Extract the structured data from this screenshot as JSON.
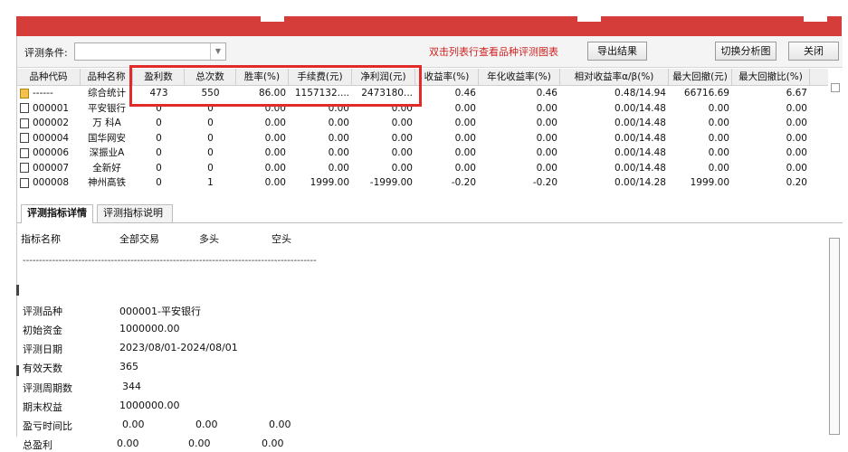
{
  "toolbar": {
    "condition_label": "评测条件:",
    "condition_value": "",
    "hint": "双击列表行查看品种评测图表",
    "export_label": "导出结果",
    "chart_label": "切换分析图",
    "close_label": "关闭"
  },
  "grid": {
    "columns": [
      "品种代码",
      "品种名称",
      "盈利数",
      "总次数",
      "胜率(%)",
      "手续费(元)",
      "净利润(元)",
      "收益率(%)",
      "年化收益率(%)",
      "相对收益率α/β(%)",
      "最大回撤(元)",
      "最大回撤比(%)"
    ],
    "rows": [
      {
        "icon": "folder",
        "code": "------",
        "name": "综合统计",
        "win": "473",
        "total": "550",
        "rate": "86.00",
        "fee": "1157132....",
        "net": "2473180...",
        "ret": "0.46",
        "annual": "0.46",
        "rel": "0.48/14.94",
        "dd": "66716.69",
        "ddr": "6.67"
      },
      {
        "icon": "box",
        "code": "000001",
        "name": "平安银行",
        "win": "0",
        "total": "0",
        "rate": "0.00",
        "fee": "0.00",
        "net": "0.00",
        "ret": "0.00",
        "annual": "0.00",
        "rel": "0.00/14.48",
        "dd": "0.00",
        "ddr": "0.00"
      },
      {
        "icon": "box",
        "code": "000002",
        "name": "万 科A",
        "win": "0",
        "total": "0",
        "rate": "0.00",
        "fee": "0.00",
        "net": "0.00",
        "ret": "0.00",
        "annual": "0.00",
        "rel": "0.00/14.48",
        "dd": "0.00",
        "ddr": "0.00"
      },
      {
        "icon": "box",
        "code": "000004",
        "name": "国华网安",
        "win": "0",
        "total": "0",
        "rate": "0.00",
        "fee": "0.00",
        "net": "0.00",
        "ret": "0.00",
        "annual": "0.00",
        "rel": "0.00/14.48",
        "dd": "0.00",
        "ddr": "0.00"
      },
      {
        "icon": "box",
        "code": "000006",
        "name": "深振业A",
        "win": "0",
        "total": "0",
        "rate": "0.00",
        "fee": "0.00",
        "net": "0.00",
        "ret": "0.00",
        "annual": "0.00",
        "rel": "0.00/14.48",
        "dd": "0.00",
        "ddr": "0.00"
      },
      {
        "icon": "box",
        "code": "000007",
        "name": "全新好",
        "win": "0",
        "total": "0",
        "rate": "0.00",
        "fee": "0.00",
        "net": "0.00",
        "ret": "0.00",
        "annual": "0.00",
        "rel": "0.00/14.48",
        "dd": "0.00",
        "ddr": "0.00"
      },
      {
        "icon": "box",
        "code": "000008",
        "name": "神州高铁",
        "win": "0",
        "total": "1",
        "rate": "0.00",
        "fee": "1999.00",
        "net": "-1999.00",
        "ret": "-0.20",
        "annual": "-0.20",
        "rel": "0.00/14.28",
        "dd": "1999.00",
        "ddr": "0.20"
      }
    ]
  },
  "tabs": [
    {
      "label": "评测指标详情",
      "active": true
    },
    {
      "label": "评测指标说明",
      "active": false
    }
  ],
  "detail": {
    "header": {
      "name": "指标名称",
      "all": "全部交易",
      "long": "多头",
      "short": "空头"
    },
    "divider": "------------------------------------------------------------------------------------------",
    "rows": [
      {
        "label": "评测品种",
        "values": [
          "000001-平安银行"
        ]
      },
      {
        "label": "初始资金",
        "values": [
          "1000000.00"
        ]
      },
      {
        "label": "评测日期",
        "values": [
          "2023/08/01-2024/08/01"
        ]
      },
      {
        "label": "有效天数",
        "values": [
          "365"
        ]
      },
      {
        "label": "评测周期数",
        "values": [
          "344"
        ]
      },
      {
        "label": "期末权益",
        "values": [
          "1000000.00"
        ]
      },
      {
        "label": "盈亏时间比",
        "values": [
          "0.00",
          "0.00",
          "0.00"
        ]
      },
      {
        "label": "总盈利",
        "values": [
          "0.00",
          "0.00",
          "0.00"
        ]
      }
    ]
  }
}
